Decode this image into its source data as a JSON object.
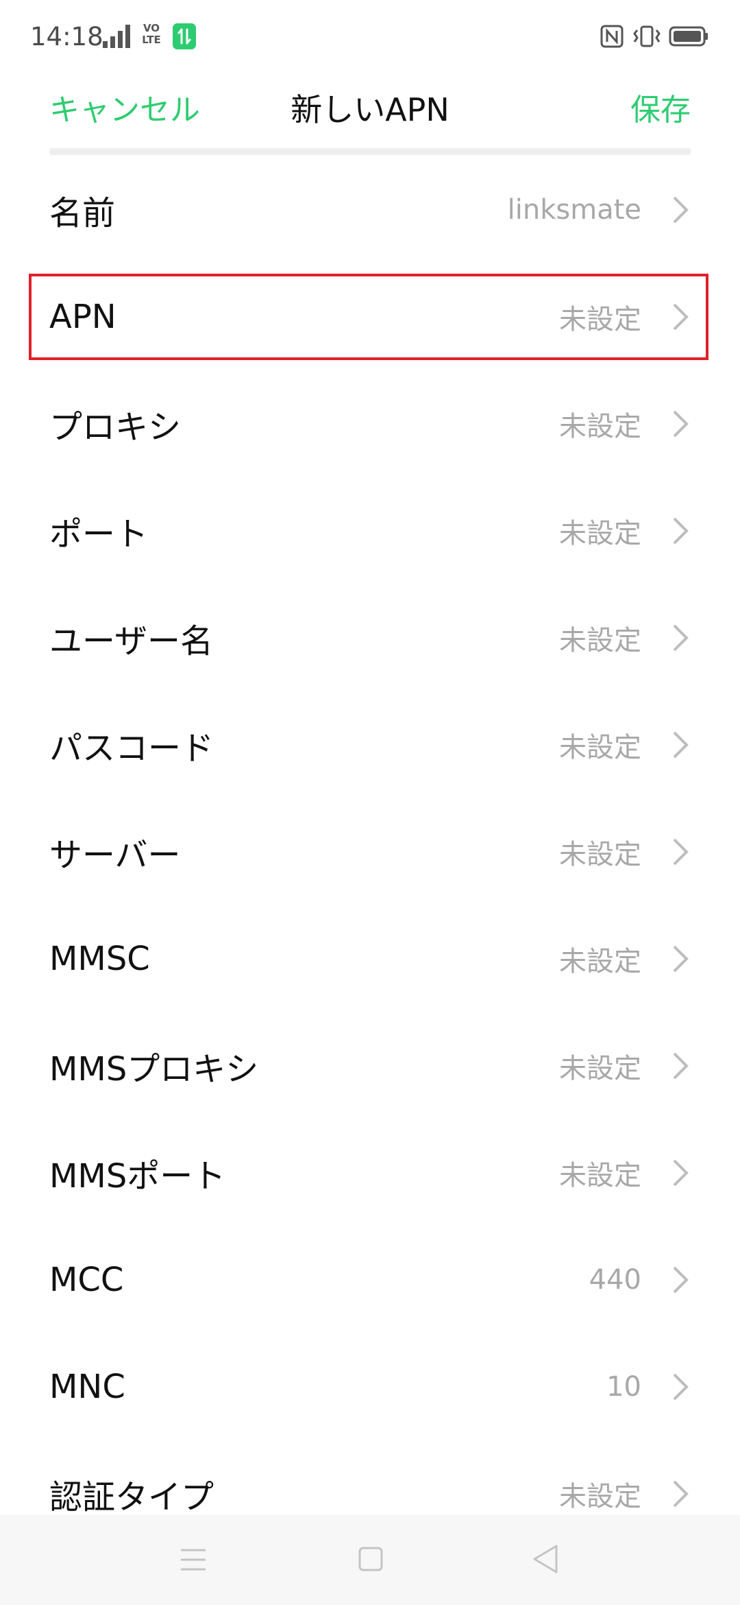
{
  "status_bar": {
    "time": "14:18",
    "volte_top": "VO",
    "volte_bottom": "LTE",
    "icons": [
      "signal-icon",
      "volte-icon",
      "data-transfer-icon",
      "nfc-icon",
      "vibrate-icon",
      "battery-icon"
    ]
  },
  "header": {
    "cancel_label": "キャンセル",
    "title": "新しいAPN",
    "save_label": "保存"
  },
  "colors": {
    "accent": "#2ecc71",
    "highlight_border": "#e0202a",
    "value_text": "#a8a8a8"
  },
  "rows": [
    {
      "label": "名前",
      "value": "linksmate"
    },
    {
      "label": "APN",
      "value": "未設定"
    },
    {
      "label": "プロキシ",
      "value": "未設定"
    },
    {
      "label": "ポート",
      "value": "未設定"
    },
    {
      "label": "ユーザー名",
      "value": "未設定"
    },
    {
      "label": "パスコード",
      "value": "未設定"
    },
    {
      "label": "サーバー",
      "value": "未設定"
    },
    {
      "label": "MMSC",
      "value": "未設定"
    },
    {
      "label": "MMSプロキシ",
      "value": "未設定"
    },
    {
      "label": "MMSポート",
      "value": "未設定"
    },
    {
      "label": "MCC",
      "value": "440"
    },
    {
      "label": "MNC",
      "value": "10"
    },
    {
      "label": "認証タイプ",
      "value": "未設定"
    }
  ],
  "nav_bar": {
    "icons": [
      "menu-icon",
      "home-icon",
      "back-icon"
    ]
  }
}
